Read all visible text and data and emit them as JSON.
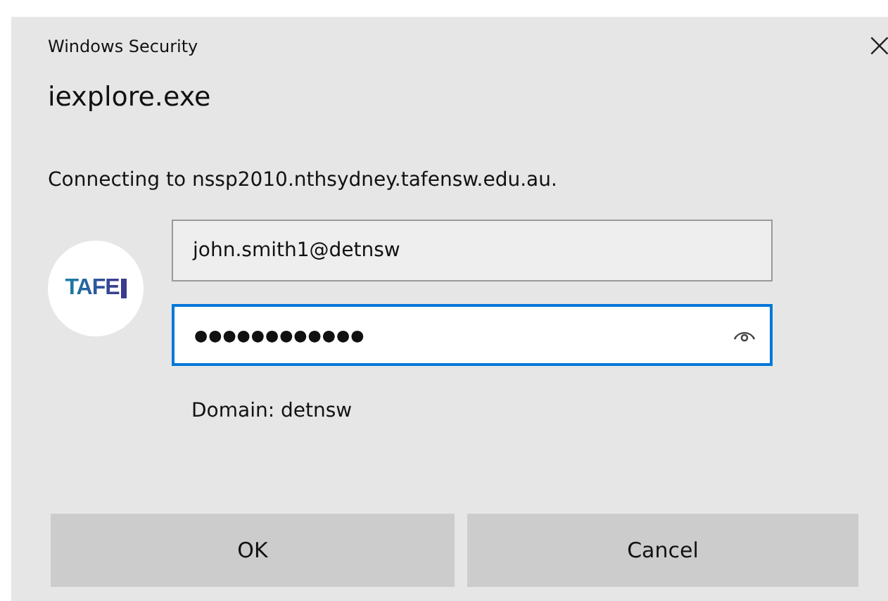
{
  "window": {
    "title": "Windows Security",
    "close": "×"
  },
  "app_name": "iexplore.exe",
  "message": "Connecting to nssp2010.nthsydney.tafensw.edu.au.",
  "logo": {
    "text": "TAFE"
  },
  "username": {
    "value": "john.smith1@detnsw",
    "focused": false
  },
  "password": {
    "value": "●●●●●●●●●●●●",
    "focused": true
  },
  "domain": "Domain: detnsw",
  "buttons": [
    "OK",
    "Cancel"
  ]
}
